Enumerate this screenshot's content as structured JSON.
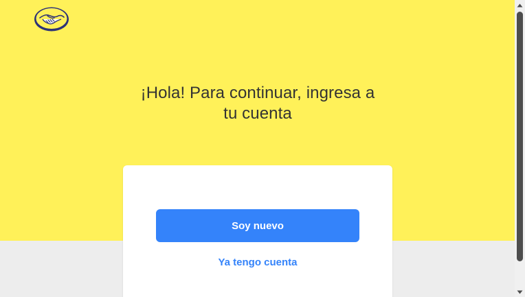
{
  "brand": {
    "logo_icon": "mercado-libre-handshake-logo",
    "colors": {
      "yellow": "#fff159",
      "primary_blue": "#3483fa",
      "background_gray": "#ededed"
    }
  },
  "main": {
    "headline_line1": "¡Hola! Para continuar, ingresa a",
    "headline_line2": "tu cuenta"
  },
  "card": {
    "new_user_button_label": "Soy nuevo",
    "existing_account_link": "Ya tengo cuenta"
  },
  "scrollbar": {
    "up_icon": "scroll-up-arrow-icon",
    "down_icon": "scroll-down-arrow-icon"
  }
}
